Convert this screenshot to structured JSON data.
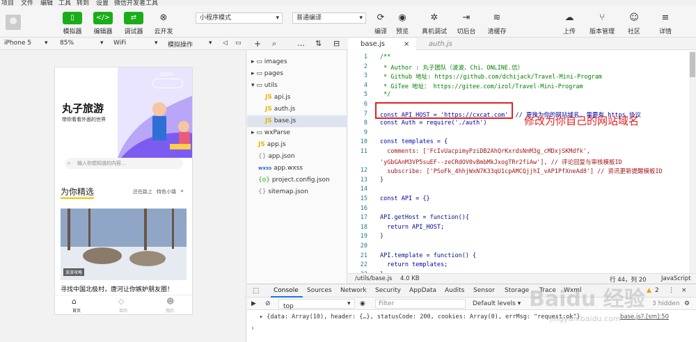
{
  "menubar": {
    "items": [
      "项目",
      "文件",
      "编辑",
      "工具",
      "转到",
      "设置",
      "微信开发者工具"
    ]
  },
  "toolbar": {
    "simulator_label": "模拟器",
    "editor_label": "编辑器",
    "debugger_label": "调试器",
    "cloud_label": "云开发",
    "mode_select": "小程序模式",
    "compile_select": "普通编译",
    "compile_label": "编译",
    "preview_label": "预览",
    "real_debug_label": "真机调试",
    "background_label": "切后台",
    "clear_cache_label": "清缓存",
    "upload_label": "上传",
    "version_label": "版本管理",
    "community_label": "社区",
    "details_label": "详情"
  },
  "devicebar": {
    "device": "iPhone 5",
    "zoom": "85%",
    "network": "WiFi",
    "operation": "模拟操作"
  },
  "phone": {
    "percent": "100%",
    "title": "丸子旅游",
    "subtitle": "带你看看外面的世界",
    "search_placeholder": "输入你想知道的内容...",
    "section_title": "为你精选",
    "link1": "还在路上",
    "link2": "特色小镇",
    "badge": "旅游攻略",
    "article_title": "寻找中国北极村，唐河让你嫉妒朋友圈！",
    "tabs": [
      "首页",
      "目的",
      "我的"
    ]
  },
  "explorer": {
    "items": [
      "images",
      "pages",
      "utils",
      "api.js",
      "auth.js",
      "base.js",
      "wxParse",
      "app.js",
      "app.json",
      "app.wxss",
      "project.config.json",
      "sitemap.json"
    ]
  },
  "editor": {
    "tabs": [
      "base.js",
      "auth.js"
    ],
    "lines": [
      {
        "n": "1",
        "t": "/**"
      },
      {
        "n": "2",
        "t": " * Author : 丸子团队（波波、Chi、ONLINE.信）"
      },
      {
        "n": "3",
        "t": " * Github 地址: https://github.com/dchijack/Travel-Mini-Program"
      },
      {
        "n": "4",
        "t": " * GiTee 地址： https://gitee.com/izol/Travel-Mini-Program"
      },
      {
        "n": "5",
        "t": " */"
      },
      {
        "n": "6",
        "t": ""
      },
      {
        "n": "7",
        "t": "const API_HOST = 'https://cxcat.com'  // 更换为你的网站域名, 需要有 https 协议"
      },
      {
        "n": "8",
        "t": "const Auth = require('./auth')"
      },
      {
        "n": "9",
        "t": ""
      },
      {
        "n": "10",
        "t": "const templates = {"
      },
      {
        "n": "11",
        "t": "  comments: ['FcIvUacpimyPziDB2AhQrKxrdsNnM3g_cMDxjSKMdfk',"
      },
      {
        "n": "",
        "t": "'yGbGAnM3VP5suEF--zeCRdOV0vBmbMkJxogTRr2fiAw'], // 评论回复与审核模板ID"
      },
      {
        "n": "12",
        "t": "  subscribe: ['PSoFk_4hhjWxN7K33qU1cpAMCQjjhI_vAP1PfXneAd8'] // 资讯更新提醒模板ID"
      },
      {
        "n": "13",
        "t": "}"
      },
      {
        "n": "14",
        "t": ""
      },
      {
        "n": "15",
        "t": "const API = {}"
      },
      {
        "n": "16",
        "t": ""
      },
      {
        "n": "17",
        "t": "API.getHost = function(){"
      },
      {
        "n": "18",
        "t": "  return API_HOST;"
      },
      {
        "n": "19",
        "t": "}"
      },
      {
        "n": "20",
        "t": ""
      },
      {
        "n": "21",
        "t": "API.template = function() {"
      },
      {
        "n": "22",
        "t": "  return templates;"
      },
      {
        "n": "23",
        "t": "}"
      }
    ]
  },
  "statusbar": {
    "path": "/utils/base.js",
    "size": "4.0 KB",
    "position": "行 44，列 20",
    "lang": "JavaScript"
  },
  "console": {
    "tabs": [
      "Console",
      "Sources",
      "Network",
      "Security",
      "AppData",
      "Audits",
      "Sensor",
      "Storage",
      "Trace",
      "Wxml"
    ],
    "context": "top",
    "filter_placeholder": "Filter",
    "levels": "Default levels ▾",
    "hidden": "3 hidden",
    "warn_count": "2",
    "log": "▸ {data: Array(10), header: {…}, statusCode: 200, cookies: Array(0), errMsg: \"request:ok\"}",
    "source": "base.js?.[sm]:50"
  },
  "annotation": "修改为你自己的网站域名",
  "watermark": "Baidu 经验",
  "watermark2": "jingyan.baidu.com"
}
